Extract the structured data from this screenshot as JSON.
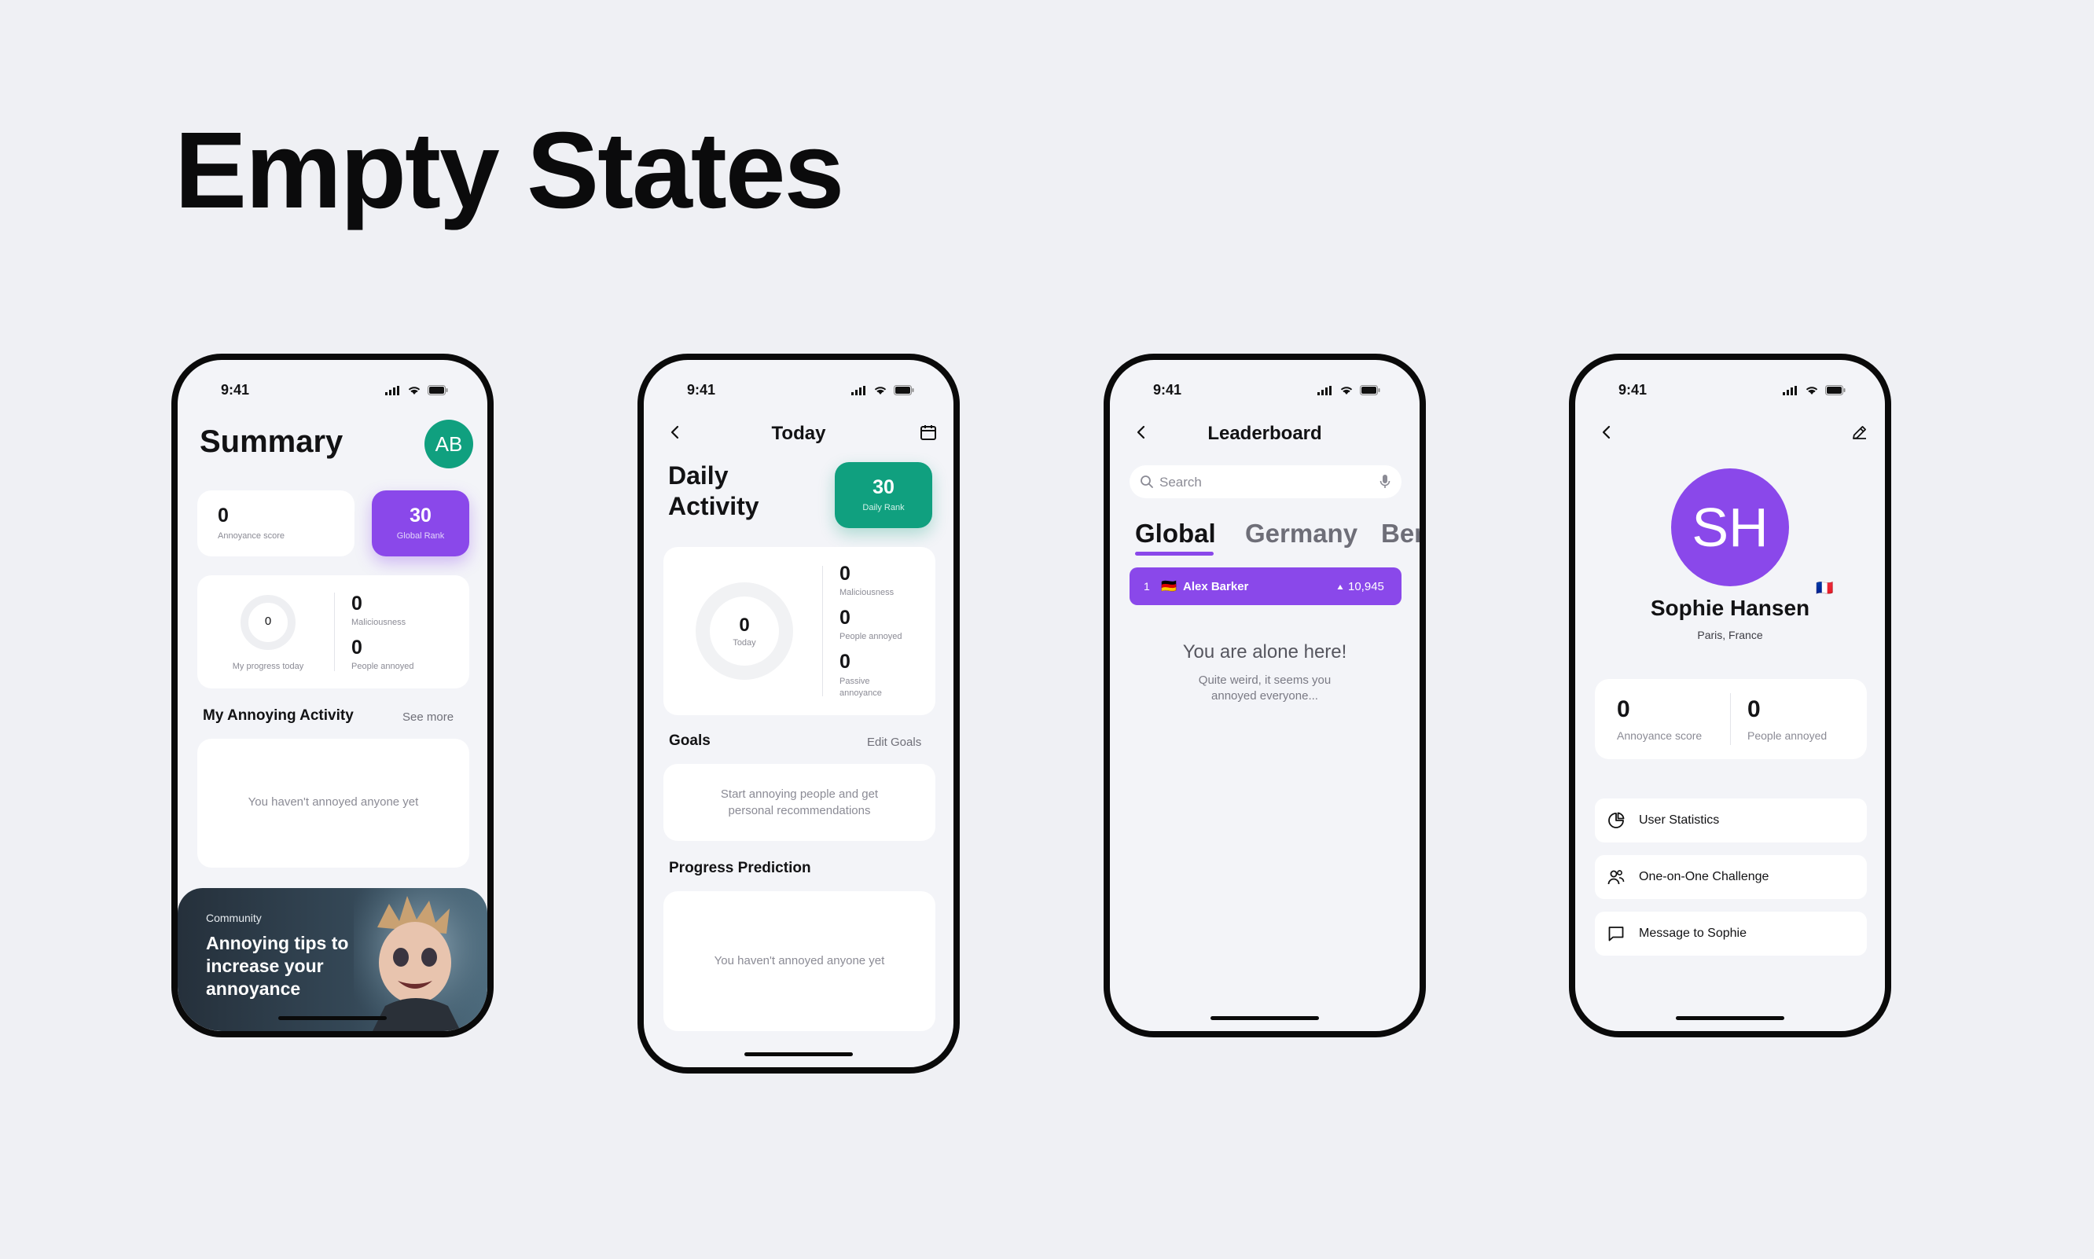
{
  "page": {
    "title": "Empty States"
  },
  "colors": {
    "purple": "#8a48ea",
    "green": "#10a07f",
    "background": "#eff0f4"
  },
  "status_time": "9:41",
  "summary": {
    "title": "Summary",
    "avatar_initials": "AB",
    "annoyance_value": "0",
    "annoyance_label": "Annoyance score",
    "rank_value": "30",
    "rank_label": "Global Rank",
    "ring_value": "0",
    "ring_label": "My progress today",
    "maliciousness_value": "0",
    "maliciousness_label": "Maliciousness",
    "people_value": "0",
    "people_label": "People annoyed",
    "activity_title": "My Annoying Activity",
    "see_more": "See more",
    "empty_activity": "You haven't annoyed anyone yet",
    "community_label": "Community",
    "community_title": "Annoying tips to increase your annoyance"
  },
  "today": {
    "title": "Today",
    "heading": "Daily Activity",
    "rank_value": "30",
    "rank_label": "Daily Rank",
    "ring_value": "0",
    "ring_label": "Today",
    "maliciousness_value": "0",
    "maliciousness_label": "Maliciousness",
    "people_value": "0",
    "people_label": "People annoyed",
    "passive_value": "0",
    "passive_label": "Passive annoyance",
    "goals_title": "Goals",
    "edit_goals": "Edit Goals",
    "goals_empty": "Start annoying people and get personal recommendations",
    "prediction_title": "Progress Prediction",
    "prediction_empty": "You haven't annoyed anyone yet"
  },
  "leaderboard": {
    "title": "Leaderboard",
    "search_placeholder": "Search",
    "tabs": [
      "Global",
      "Germany",
      "Ber"
    ],
    "row_rank": "1",
    "row_flag": "🇩🇪",
    "row_name": "Alex Barker",
    "row_score": "10,945",
    "empty_title": "You are alone here!",
    "empty_sub": "Quite weird, it seems you annoyed everyone..."
  },
  "profile": {
    "initials": "SH",
    "name": "Sophie Hansen",
    "flag": "🇫🇷",
    "location": "Paris, France",
    "annoyance_value": "0",
    "annoyance_label": "Annoyance score",
    "people_value": "0",
    "people_label": "People annoyed",
    "actions": [
      "User Statistics",
      "One-on-One Challenge",
      "Message to Sophie"
    ]
  }
}
